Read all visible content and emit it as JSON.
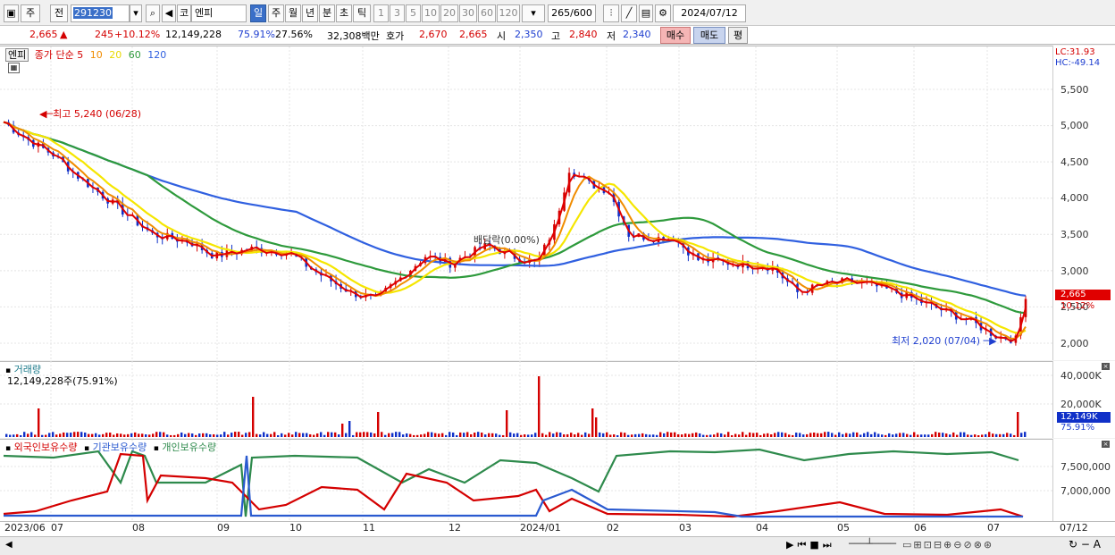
{
  "toolbar": {
    "market_label": "주",
    "prev_label": "전",
    "code": "291230",
    "market2": "코",
    "stock_name": "엔피",
    "periods": [
      "일",
      "주",
      "월",
      "년",
      "분",
      "초",
      "틱"
    ],
    "intervals": [
      "1",
      "3",
      "5",
      "10",
      "20",
      "30",
      "60",
      "120"
    ],
    "count": "265",
    "count_max": "/600",
    "date": "2024/07/12"
  },
  "info": {
    "price": "2,665",
    "change_arrow": "▲",
    "change": "245",
    "change_pct": "+10.12%",
    "volume": "12,149,228",
    "volume_pct": "75.91%",
    "turnover_pct": "27.56%",
    "amount": "32,308백만",
    "quote_label": "호가",
    "ask": "2,670",
    "bid": "2,665",
    "open_label": "시",
    "open": "2,350",
    "high_label": "고",
    "high": "2,840",
    "low_label": "저",
    "low": "2,340",
    "buy_btn": "매수",
    "sell_btn": "매도",
    "eval_btn": "평"
  },
  "price_panel": {
    "name_tag": "엔피",
    "legend": {
      "title": "종가 단순",
      "ma5": "5",
      "ma10": "10",
      "ma20": "20",
      "ma60": "60",
      "ma120": "120"
    },
    "lc": "LC:31.93",
    "hc": "HC:-49.14",
    "y_ticks": [
      "5,500",
      "5,000",
      "4,500",
      "4,000",
      "3,500",
      "3,000",
      "2,500",
      "2,000"
    ],
    "current_price_tag": "2,665",
    "current_pct_tag": "10.12%",
    "annotations": {
      "high": "최고 5,240 (06/28)",
      "low": "최저 2,020 (07/04)",
      "dividend": "배당락(0.00%)"
    },
    "colors": {
      "ma5": "#e00000",
      "ma10": "#f08c00",
      "ma20": "#f5e600",
      "ma60": "#2e9a3c",
      "ma120": "#3060e0",
      "up": "#d40000",
      "down": "#1030c8"
    }
  },
  "volume_panel": {
    "title": "거래량",
    "value": "12,149,228주(75.91%)",
    "y_ticks": [
      "40,000K",
      "20,000K"
    ],
    "current_tag": "12,149K",
    "current_pct": "75.91%"
  },
  "holdings_panel": {
    "legend": {
      "foreign": "외국인보유수량",
      "institution": "기관보유수량",
      "individual": "개인보유수량"
    },
    "y_ticks": [
      "7,500,000",
      "7,000,000"
    ]
  },
  "x_axis": [
    "2023/06",
    "07",
    "08",
    "09",
    "10",
    "11",
    "12",
    "2024/01",
    "02",
    "03",
    "04",
    "05",
    "06",
    "07",
    "07/12"
  ]
}
